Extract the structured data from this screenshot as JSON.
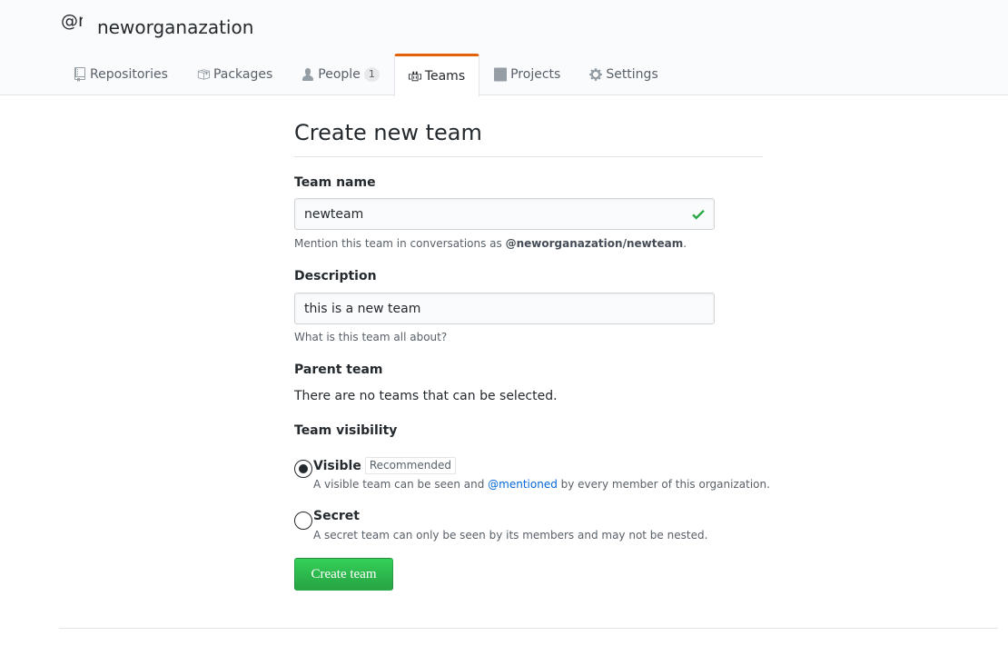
{
  "org": {
    "avatar_text": "@ne",
    "name": "neworganazation"
  },
  "tabs": [
    {
      "label": "Repositories",
      "icon": "repo-icon",
      "selected": false
    },
    {
      "label": "Packages",
      "icon": "package-icon",
      "selected": false
    },
    {
      "label": "People",
      "icon": "person-icon",
      "counter": "1",
      "selected": false
    },
    {
      "label": "Teams",
      "icon": "teams-icon",
      "selected": true
    },
    {
      "label": "Projects",
      "icon": "project-icon",
      "selected": false
    },
    {
      "label": "Settings",
      "icon": "gear-icon",
      "selected": false
    }
  ],
  "form": {
    "title": "Create new team",
    "team_name": {
      "label": "Team name",
      "value": "newteam",
      "note_prefix": "Mention this team in conversations as ",
      "note_mention": "@neworganazation/newteam",
      "note_suffix": "."
    },
    "description": {
      "label": "Description",
      "value": "this is a new team",
      "note": "What is this team all about?"
    },
    "parent_team": {
      "label": "Parent team",
      "text": "There are no teams that can be selected."
    },
    "visibility": {
      "label": "Team visibility",
      "visible": {
        "label": "Visible",
        "badge": "Recommended",
        "note_prefix": "A visible team can be seen and ",
        "note_link": "@mentioned",
        "note_suffix": " by every member of this organization.",
        "checked": true
      },
      "secret": {
        "label": "Secret",
        "note": "A secret team can only be seen by its members and may not be nested.",
        "checked": false
      }
    },
    "submit_label": "Create team"
  },
  "colors": {
    "accent_tab": "#e36209",
    "primary_button": "#28a745",
    "link": "#0366d6",
    "success_check": "#28a745"
  }
}
